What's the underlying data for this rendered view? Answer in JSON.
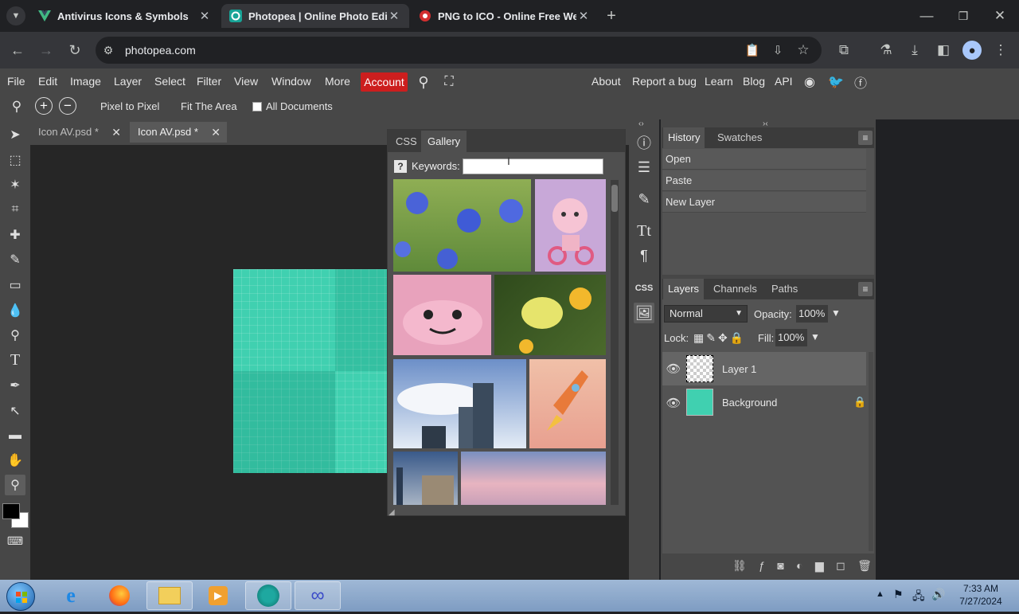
{
  "browser": {
    "tabs": [
      {
        "title": "Antivirus Icons & Symbols",
        "active": false
      },
      {
        "title": "Photopea | Online Photo Editor",
        "active": true
      },
      {
        "title": "PNG to ICO - Online Free Web",
        "active": false
      }
    ],
    "url": "photopea.com"
  },
  "menu": {
    "items": [
      "File",
      "Edit",
      "Image",
      "Layer",
      "Select",
      "Filter",
      "View",
      "Window",
      "More"
    ],
    "account": "Account",
    "links": [
      "About",
      "Report a bug",
      "Learn",
      "Blog",
      "API"
    ]
  },
  "options": {
    "pixel_to_pixel": "Pixel to Pixel",
    "fit_area": "Fit The Area",
    "all_documents": "All Documents"
  },
  "documents": {
    "tabs": [
      "Icon AV.psd *",
      "Icon AV.psd *"
    ]
  },
  "gallery": {
    "tabs": [
      "CSS",
      "Gallery"
    ],
    "help": "?",
    "keywords_label": "Keywords:",
    "keywords_value": ""
  },
  "iconbar": {
    "css": "CSS"
  },
  "history": {
    "tabs": [
      "History",
      "Swatches"
    ],
    "entries": [
      "Open",
      "Paste",
      "New Layer"
    ]
  },
  "layers_panel": {
    "tabs": [
      "Layers",
      "Channels",
      "Paths"
    ],
    "blend_mode": "Normal",
    "opacity_label": "Opacity:",
    "opacity_value": "100%",
    "lock_label": "Lock:",
    "fill_label": "Fill:",
    "fill_value": "100%",
    "layers": [
      {
        "name": "Layer 1",
        "selected": true,
        "locked": false
      },
      {
        "name": "Background",
        "selected": false,
        "locked": true
      }
    ]
  },
  "taskbar": {
    "time": "7:33 AM",
    "date": "7/27/2024"
  },
  "colors": {
    "accent_account": "#cc1e1e",
    "canvas_fill": "#40d0b0"
  }
}
